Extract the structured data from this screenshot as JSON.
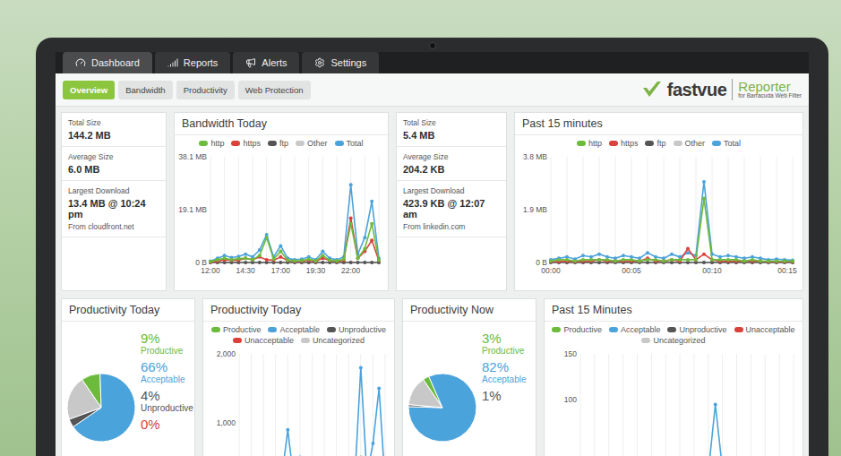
{
  "logo": {
    "name": "fastvue",
    "product": "Reporter",
    "subtitle": "for Barracuda Web Filter"
  },
  "nav": [
    {
      "label": "Dashboard",
      "selected": true
    },
    {
      "label": "Reports",
      "selected": false
    },
    {
      "label": "Alerts",
      "selected": false
    },
    {
      "label": "Settings",
      "selected": false
    }
  ],
  "subnav": [
    {
      "label": "Overview",
      "selected": true
    },
    {
      "label": "Bandwidth",
      "selected": false
    },
    {
      "label": "Productivity",
      "selected": false
    },
    {
      "label": "Web Protection",
      "selected": false
    }
  ],
  "bandwidth_today": {
    "stats": [
      {
        "label": "Total Size",
        "value": "144.2 MB"
      },
      {
        "label": "Average Size",
        "value": "6.0 MB"
      },
      {
        "label": "Largest Download",
        "value": "13.4 MB @ 10:24 pm",
        "from": "From cloudfront.net"
      }
    ],
    "chart": {
      "title": "Bandwidth Today",
      "ticks": [
        {
          "label": "38.1 MB",
          "value": 38.1
        },
        {
          "label": "19.1 MB",
          "value": 19.1
        },
        {
          "label": "0 B",
          "value": 0
        }
      ],
      "x_labels": [
        {
          "label": "12:00",
          "at": 0
        },
        {
          "label": "14:30",
          "at": 5
        },
        {
          "label": "17:00",
          "at": 10
        },
        {
          "label": "19:30",
          "at": 15
        },
        {
          "label": "22:00",
          "at": 20
        }
      ],
      "series": [
        {
          "name": "http",
          "color": "#6cbb3c",
          "values": [
            0.3,
            1,
            1.5,
            1,
            1.4,
            1.5,
            1,
            2.5,
            9,
            1.2,
            4,
            0.8,
            0.6,
            0.7,
            1.2,
            0.6,
            2.5,
            0.8,
            0.6,
            1.2,
            14,
            1.5,
            5,
            14,
            0.8
          ]
        },
        {
          "name": "https",
          "color": "#d9413a",
          "values": [
            0.2,
            0.5,
            1,
            0.8,
            0.8,
            1.5,
            1,
            2,
            1,
            0.8,
            2,
            0.7,
            0.4,
            0.5,
            0.8,
            0.4,
            1.5,
            0.7,
            0.4,
            0.8,
            16,
            1.5,
            4,
            8,
            0.7
          ]
        },
        {
          "name": "ftp",
          "color": "#555555",
          "values": [
            0,
            0,
            0,
            0,
            0,
            0,
            0,
            0,
            0,
            0,
            0,
            0,
            0,
            0,
            0,
            0,
            0,
            0,
            0,
            0,
            0,
            0,
            0,
            0,
            0
          ]
        },
        {
          "name": "Other",
          "color": "#c8c8c8",
          "values": [
            0,
            0,
            0,
            0,
            0,
            0,
            0,
            0,
            0,
            0,
            0,
            0,
            0,
            0,
            0,
            0,
            0,
            0,
            0,
            0,
            0,
            0,
            0,
            0,
            0
          ]
        },
        {
          "name": "Total",
          "color": "#4ba3dc",
          "values": [
            0.5,
            1.5,
            2.5,
            1.8,
            2.2,
            3,
            2,
            4.5,
            10,
            2,
            6,
            1.5,
            1,
            1.2,
            2,
            1,
            4,
            1.5,
            1,
            2,
            28,
            3,
            9,
            22,
            1.5
          ]
        }
      ]
    }
  },
  "bandwidth_recent": {
    "stats": [
      {
        "label": "Total Size",
        "value": "5.4 MB"
      },
      {
        "label": "Average Size",
        "value": "204.2 KB"
      },
      {
        "label": "Largest Download",
        "value": "423.9 KB @ 12:07 am",
        "from": "From linkedin.com"
      }
    ],
    "chart": {
      "title": "Past 15 minutes",
      "ticks": [
        {
          "label": "3.8 MB",
          "value": 3.8
        },
        {
          "label": "1.9 MB",
          "value": 1.9
        },
        {
          "label": "0 B",
          "value": 0
        }
      ],
      "x_labels": [
        {
          "label": "00:00",
          "at": 0
        },
        {
          "label": "00:05",
          "at": 10
        },
        {
          "label": "00:10",
          "at": 20
        },
        {
          "label": "00:15",
          "at": 30
        }
      ],
      "series": [
        {
          "name": "http",
          "color": "#6cbb3c",
          "values": [
            0.05,
            0.1,
            0.1,
            0.05,
            0.1,
            0.1,
            0.1,
            0.1,
            0.05,
            0.1,
            0.1,
            0.05,
            0.1,
            0.1,
            0.05,
            0.1,
            0.1,
            0.1,
            0.1,
            2.3,
            0.1,
            0.1,
            0.1,
            0.1,
            0.05,
            0.1,
            0.05,
            0.05,
            0.05,
            0.05,
            0.05
          ]
        },
        {
          "name": "https",
          "color": "#d9413a",
          "values": [
            0.03,
            0.03,
            0.05,
            0.03,
            0.05,
            0.05,
            0.1,
            0.05,
            0.05,
            0.05,
            0.05,
            0.05,
            0.15,
            0.05,
            0.05,
            0.1,
            0.05,
            0.5,
            0.1,
            0.3,
            0.1,
            0.05,
            0.05,
            0.05,
            0.05,
            0.05,
            0.05,
            0.03,
            0.03,
            0.03,
            0.03
          ]
        },
        {
          "name": "ftp",
          "color": "#555555",
          "values": [
            0,
            0,
            0,
            0,
            0,
            0,
            0,
            0,
            0,
            0,
            0,
            0,
            0,
            0,
            0,
            0,
            0,
            0,
            0,
            0,
            0,
            0,
            0,
            0,
            0,
            0,
            0,
            0,
            0,
            0,
            0
          ]
        },
        {
          "name": "Other",
          "color": "#c8c8c8",
          "values": [
            0,
            0,
            0,
            0,
            0,
            0,
            0,
            0,
            0,
            0,
            0,
            0,
            0,
            0,
            0,
            0,
            0,
            0,
            0,
            0,
            0,
            0,
            0,
            0,
            0,
            0,
            0,
            0,
            0,
            0,
            0
          ]
        },
        {
          "name": "Total",
          "color": "#4ba3dc",
          "values": [
            0.1,
            0.15,
            0.2,
            0.12,
            0.25,
            0.2,
            0.3,
            0.2,
            0.15,
            0.25,
            0.2,
            0.15,
            0.35,
            0.2,
            0.15,
            0.3,
            0.2,
            0.35,
            0.25,
            2.9,
            0.3,
            0.2,
            0.25,
            0.2,
            0.15,
            0.2,
            0.15,
            0.1,
            0.12,
            0.1,
            0.08
          ]
        }
      ]
    }
  },
  "productivity_today": {
    "title": "Productivity Today",
    "figures": [
      {
        "value": "9%",
        "label": "Productive",
        "color": "#6cbb3c"
      },
      {
        "value": "66%",
        "label": "Acceptable",
        "color": "#4ba3dc"
      },
      {
        "value": "4%",
        "label": "Unproductive",
        "color": "#555555"
      },
      {
        "value": "0%",
        "label": "",
        "color": "#d9413a"
      }
    ],
    "pie": [
      {
        "share": 0.09,
        "color": "#6cbb3c"
      },
      {
        "share": 0.66,
        "color": "#4ba3dc"
      },
      {
        "share": 0.04,
        "color": "#555555"
      },
      {
        "share": 0.0,
        "color": "#d9413a"
      },
      {
        "share": 0.21,
        "color": "#c8c8c8"
      }
    ],
    "chart": {
      "title": "Productivity Today",
      "ticks": [
        {
          "label": "2,000",
          "value": 2000
        },
        {
          "label": "1,000",
          "value": 1000
        }
      ],
      "x_labels": [],
      "series": [
        {
          "name": "Productive",
          "color": "#6cbb3c",
          "values": [
            20,
            30,
            25,
            40,
            50,
            35,
            30,
            60,
            200,
            40,
            150,
            30,
            25,
            30,
            40,
            25,
            80,
            35,
            25,
            40,
            500,
            60,
            200,
            400,
            30
          ]
        },
        {
          "name": "Acceptable",
          "color": "#4ba3dc",
          "values": [
            60,
            90,
            70,
            120,
            150,
            100,
            80,
            200,
            900,
            150,
            500,
            120,
            90,
            100,
            160,
            90,
            300,
            130,
            90,
            160,
            1800,
            240,
            700,
            1500,
            120
          ]
        },
        {
          "name": "Unproductive",
          "color": "#555555",
          "values": [
            5,
            8,
            6,
            10,
            12,
            8,
            6,
            15,
            40,
            10,
            30,
            8,
            6,
            8,
            12,
            6,
            20,
            10,
            6,
            12,
            60,
            15,
            40,
            50,
            8
          ]
        },
        {
          "name": "Unacceptable",
          "color": "#d9413a",
          "values": [
            0,
            0,
            0,
            0,
            0,
            0,
            0,
            0,
            0,
            0,
            0,
            0,
            0,
            0,
            0,
            0,
            0,
            0,
            0,
            0,
            0,
            0,
            0,
            0,
            0
          ]
        },
        {
          "name": "Uncategorized",
          "color": "#c8c8c8",
          "values": [
            10,
            15,
            12,
            20,
            25,
            18,
            14,
            30,
            120,
            25,
            80,
            20,
            15,
            18,
            25,
            15,
            50,
            22,
            15,
            25,
            300,
            40,
            120,
            250,
            20
          ]
        }
      ]
    }
  },
  "productivity_now": {
    "title": "Productivity Now",
    "figures": [
      {
        "value": "3%",
        "label": "Productive",
        "color": "#6cbb3c"
      },
      {
        "value": "82%",
        "label": "Acceptable",
        "color": "#4ba3dc"
      },
      {
        "value": "1%",
        "label": "",
        "color": "#555555"
      }
    ],
    "pie": [
      {
        "share": 0.03,
        "color": "#6cbb3c"
      },
      {
        "share": 0.82,
        "color": "#4ba3dc"
      },
      {
        "share": 0.01,
        "color": "#555555"
      },
      {
        "share": 0.0,
        "color": "#d9413a"
      },
      {
        "share": 0.14,
        "color": "#c8c8c8"
      }
    ],
    "chart": {
      "title": "Past 15 Minutes",
      "ticks": [
        {
          "label": "150",
          "value": 150
        },
        {
          "label": "100",
          "value": 100
        }
      ],
      "x_labels": [],
      "series": [
        {
          "name": "Productive",
          "color": "#6cbb3c",
          "values": [
            2,
            3,
            2,
            4,
            3,
            2,
            3,
            4,
            2,
            3,
            2,
            3,
            4,
            2,
            3,
            4,
            3,
            5,
            4,
            20,
            4,
            3,
            2,
            3,
            2,
            3,
            2,
            2,
            2,
            2,
            2
          ]
        },
        {
          "name": "Acceptable",
          "color": "#4ba3dc",
          "values": [
            12,
            15,
            18,
            14,
            20,
            16,
            22,
            18,
            14,
            20,
            17,
            15,
            24,
            18,
            16,
            22,
            19,
            26,
            21,
            95,
            24,
            18,
            20,
            17,
            15,
            16,
            14,
            12,
            13,
            12,
            11
          ]
        },
        {
          "name": "Unproductive",
          "color": "#555555",
          "values": [
            0,
            1,
            0,
            1,
            0,
            1,
            0,
            1,
            0,
            1,
            0,
            1,
            0,
            1,
            0,
            1,
            0,
            1,
            0,
            2,
            0,
            1,
            0,
            1,
            0,
            1,
            0,
            0,
            0,
            0,
            0
          ]
        },
        {
          "name": "Unacceptable",
          "color": "#d9413a",
          "values": [
            0,
            0,
            0,
            0,
            0,
            0,
            0,
            0,
            0,
            0,
            0,
            0,
            0,
            0,
            0,
            0,
            0,
            0,
            0,
            0,
            0,
            0,
            0,
            0,
            0,
            0,
            0,
            0,
            0,
            0,
            0
          ]
        },
        {
          "name": "Uncategorized",
          "color": "#c8c8c8",
          "values": [
            3,
            4,
            3,
            5,
            4,
            3,
            4,
            5,
            3,
            4,
            3,
            4,
            5,
            3,
            4,
            5,
            4,
            6,
            5,
            12,
            5,
            4,
            3,
            4,
            3,
            4,
            3,
            3,
            3,
            3,
            3
          ]
        }
      ]
    }
  }
}
